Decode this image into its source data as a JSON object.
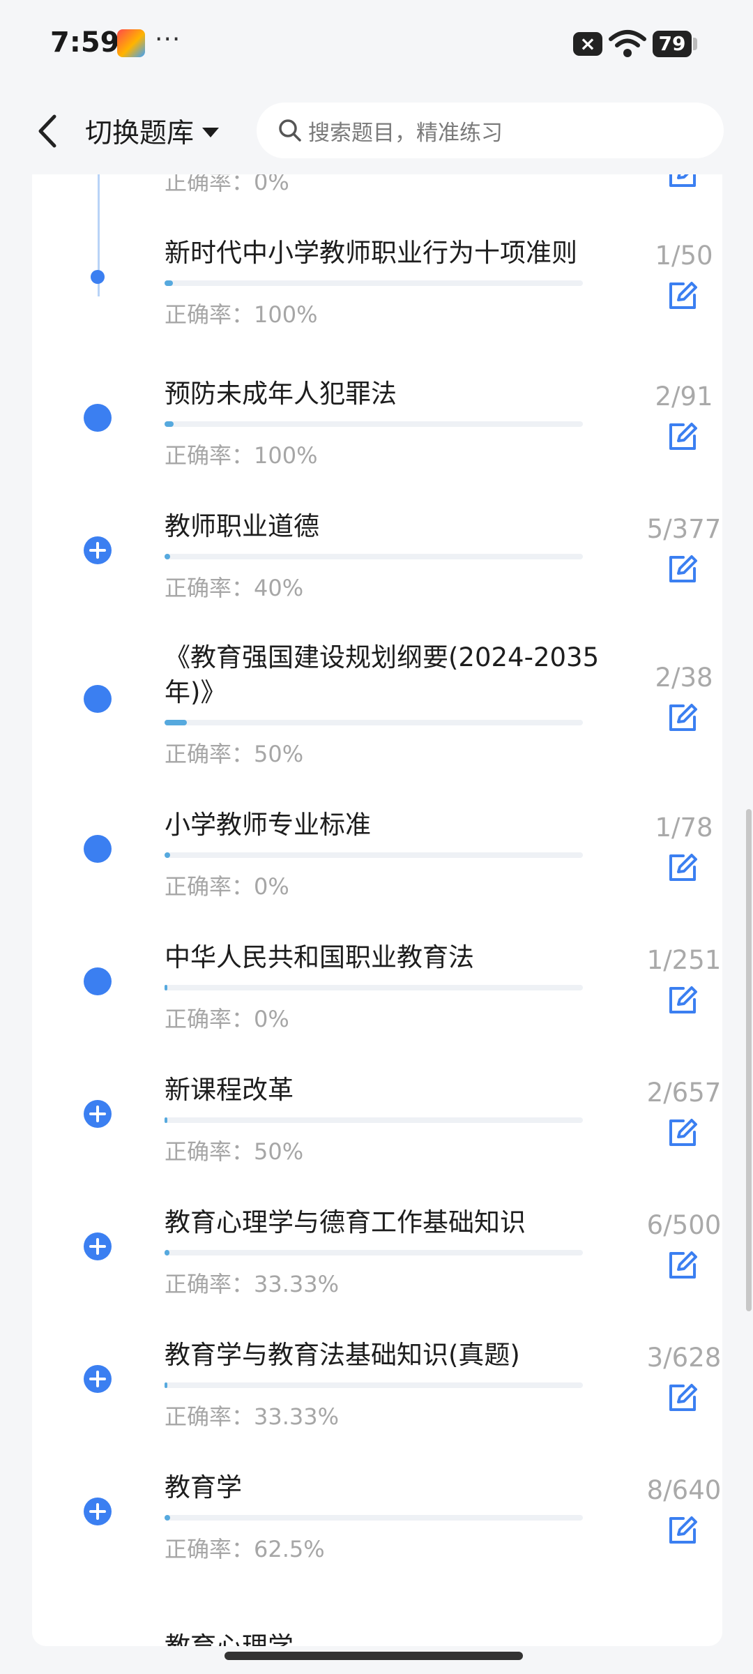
{
  "status_bar": {
    "time": "7:59",
    "dots": "···",
    "battery": "79"
  },
  "header": {
    "switch_label": "切换题库",
    "search_placeholder": "搜索题目，精准练习"
  },
  "colors": {
    "accent": "#3b7ff1",
    "progress": "#56a9de",
    "muted_text": "#a6a6a6"
  },
  "partial_top": {
    "accuracy": "正确率：0%"
  },
  "items": [
    {
      "title": "新时代中小学教师职业行为十项准则",
      "count": "1/50",
      "accuracy": "正确率：100%",
      "progress": 0.02,
      "marker": "small-dot"
    },
    {
      "title": "预防未成年人犯罪法",
      "count": "2/91",
      "accuracy": "正确率：100%",
      "progress": 0.022,
      "marker": "dot"
    },
    {
      "title": "教师职业道德",
      "count": "5/377",
      "accuracy": "正确率：40%",
      "progress": 0.013,
      "marker": "plus"
    },
    {
      "title": "《教育强国建设规划纲要(2024-2035年)》",
      "count": "2/38",
      "accuracy": "正确率：50%",
      "progress": 0.053,
      "marker": "dot"
    },
    {
      "title": "小学教师专业标准",
      "count": "1/78",
      "accuracy": "正确率：0%",
      "progress": 0.013,
      "marker": "dot"
    },
    {
      "title": "中华人民共和国职业教育法",
      "count": "1/251",
      "accuracy": "正确率：0%",
      "progress": 0.004,
      "marker": "dot"
    },
    {
      "title": "新课程改革",
      "count": "2/657",
      "accuracy": "正确率：50%",
      "progress": 0.003,
      "marker": "plus"
    },
    {
      "title": "教育心理学与德育工作基础知识",
      "count": "6/500",
      "accuracy": "正确率：33.33%",
      "progress": 0.012,
      "marker": "plus"
    },
    {
      "title": "教育学与教育法基础知识(真题)",
      "count": "3/628",
      "accuracy": "正确率：33.33%",
      "progress": 0.005,
      "marker": "plus"
    },
    {
      "title": "教育学",
      "count": "8/640",
      "accuracy": "正确率：62.5%",
      "progress": 0.0125,
      "marker": "plus"
    }
  ],
  "partial_bottom": {
    "title": "教育心理学"
  }
}
